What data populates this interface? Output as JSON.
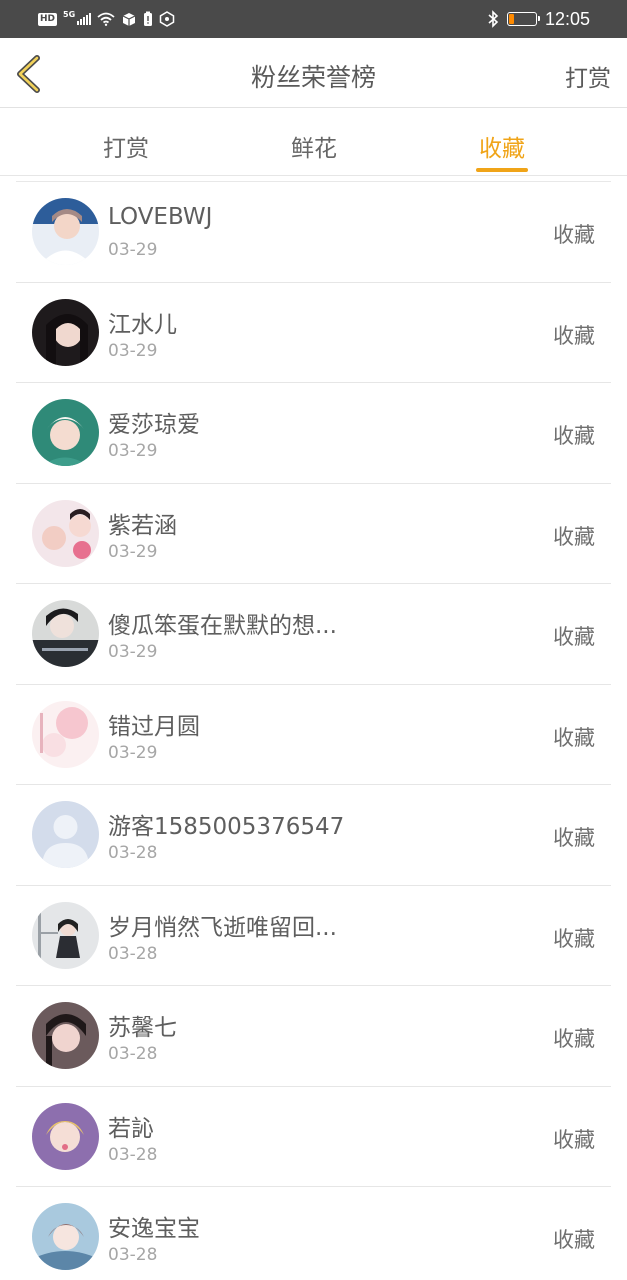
{
  "status_bar": {
    "hd": "HD",
    "network": "5G",
    "time": "12:05",
    "battery_level": 0.2,
    "battery_color": "#ff8a00",
    "icons": [
      "hd-icon",
      "signal-icon",
      "wifi-icon",
      "app-notification-icon",
      "battery-alert-icon",
      "vpn-icon",
      "bluetooth-icon",
      "battery-icon"
    ]
  },
  "nav": {
    "back_icon": "chevron-left-icon",
    "title": "粉丝荣誉榜",
    "right_label": "打赏"
  },
  "tabs": [
    {
      "label": "打赏",
      "active": false
    },
    {
      "label": "鲜花",
      "active": false
    },
    {
      "label": "收藏",
      "active": true
    }
  ],
  "accent_color": "#f0a418",
  "fans": [
    {
      "name": "LOVEBWJ",
      "date": "03-29",
      "action": "收藏",
      "avatar": "user-avatar"
    },
    {
      "name": "江水儿",
      "date": "03-29",
      "action": "收藏",
      "avatar": "user-avatar"
    },
    {
      "name": "爱莎琼爱",
      "date": "03-29",
      "action": "收藏",
      "avatar": "user-avatar"
    },
    {
      "name": "紫若涵",
      "date": "03-29",
      "action": "收藏",
      "avatar": "user-avatar"
    },
    {
      "name": "傻瓜笨蛋在默默的想...",
      "date": "03-29",
      "action": "收藏",
      "avatar": "user-avatar"
    },
    {
      "name": "错过月圆",
      "date": "03-29",
      "action": "收藏",
      "avatar": "user-avatar"
    },
    {
      "name": "游客1585005376547",
      "date": "03-28",
      "action": "收藏",
      "avatar": "default-avatar"
    },
    {
      "name": "岁月悄然飞逝唯留回...",
      "date": "03-28",
      "action": "收藏",
      "avatar": "user-avatar"
    },
    {
      "name": "苏馨七",
      "date": "03-28",
      "action": "收藏",
      "avatar": "user-avatar"
    },
    {
      "name": "若訫",
      "date": "03-28",
      "action": "收藏",
      "avatar": "user-avatar"
    },
    {
      "name": "安逸宝宝",
      "date": "03-28",
      "action": "收藏",
      "avatar": "user-avatar"
    }
  ]
}
